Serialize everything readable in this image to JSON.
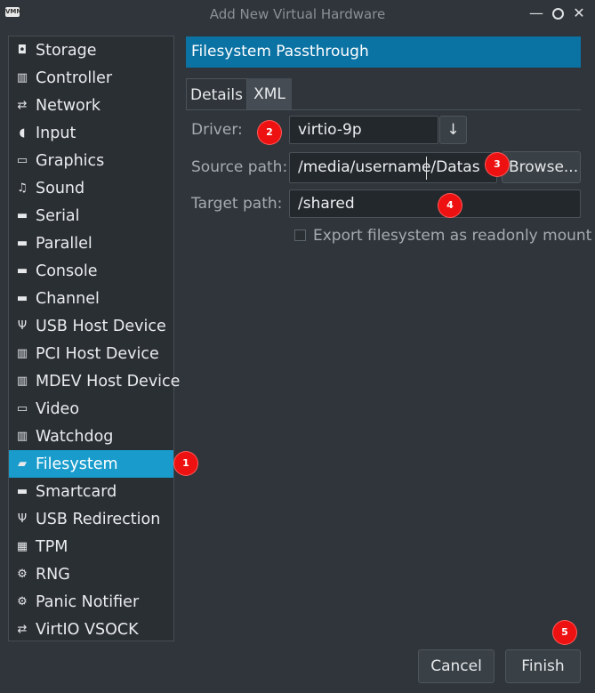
{
  "window": {
    "title": "Add New Virtual Hardware",
    "app_icon_text": "VMM",
    "controls": {
      "minimize": "—",
      "maximize": "",
      "close": "✕"
    }
  },
  "sidebar": {
    "items": [
      {
        "label": "Storage",
        "icon": "disk-icon",
        "glyph": "◘"
      },
      {
        "label": "Controller",
        "icon": "controller-icon",
        "glyph": "▥"
      },
      {
        "label": "Network",
        "icon": "network-icon",
        "glyph": "⇄"
      },
      {
        "label": "Input",
        "icon": "mouse-icon",
        "glyph": "◖"
      },
      {
        "label": "Graphics",
        "icon": "monitor-icon",
        "glyph": "▭"
      },
      {
        "label": "Sound",
        "icon": "sound-icon",
        "glyph": "♫"
      },
      {
        "label": "Serial",
        "icon": "serial-port-icon",
        "glyph": "▬"
      },
      {
        "label": "Parallel",
        "icon": "parallel-port-icon",
        "glyph": "▬"
      },
      {
        "label": "Console",
        "icon": "console-port-icon",
        "glyph": "▬"
      },
      {
        "label": "Channel",
        "icon": "channel-port-icon",
        "glyph": "▬"
      },
      {
        "label": "USB Host Device",
        "icon": "usb-icon",
        "glyph": "Ψ"
      },
      {
        "label": "PCI Host Device",
        "icon": "pci-icon",
        "glyph": "▥"
      },
      {
        "label": "MDEV Host Device",
        "icon": "mdev-icon",
        "glyph": "▥"
      },
      {
        "label": "Video",
        "icon": "video-monitor-icon",
        "glyph": "▭"
      },
      {
        "label": "Watchdog",
        "icon": "watchdog-icon",
        "glyph": "▥"
      },
      {
        "label": "Filesystem",
        "icon": "folder-icon",
        "glyph": "▰",
        "selected": true
      },
      {
        "label": "Smartcard",
        "icon": "smartcard-icon",
        "glyph": "▬"
      },
      {
        "label": "USB Redirection",
        "icon": "usb-redirection-icon",
        "glyph": "Ψ"
      },
      {
        "label": "TPM",
        "icon": "tpm-chip-icon",
        "glyph": "▦"
      },
      {
        "label": "RNG",
        "icon": "rng-gear-icon",
        "glyph": "⚙"
      },
      {
        "label": "Panic Notifier",
        "icon": "panic-gear-icon",
        "glyph": "⚙"
      },
      {
        "label": "VirtIO VSOCK",
        "icon": "vsock-network-icon",
        "glyph": "⇄"
      }
    ]
  },
  "main": {
    "header": "Filesystem Passthrough",
    "tabs": [
      {
        "label": "Details",
        "active": true
      },
      {
        "label": "XML",
        "active": false
      }
    ],
    "driver": {
      "label": "Driver:",
      "value": "virtio-9p",
      "dropdown_glyph": "↓"
    },
    "source": {
      "label": "Source path:",
      "value": "/media/username/Datas",
      "browse_label": "Browse..."
    },
    "target": {
      "label": "Target path:",
      "value": "/shared"
    },
    "readonly": {
      "label": "Export filesystem as readonly mount",
      "checked": false
    }
  },
  "footer": {
    "cancel_label": "Cancel",
    "finish_label": "Finish"
  },
  "annotations": [
    "1",
    "2",
    "3",
    "4",
    "5"
  ],
  "colors": {
    "accent": "#199ccc",
    "header": "#0b72a4",
    "badge": "#ee1111",
    "background": "#2f353a"
  }
}
